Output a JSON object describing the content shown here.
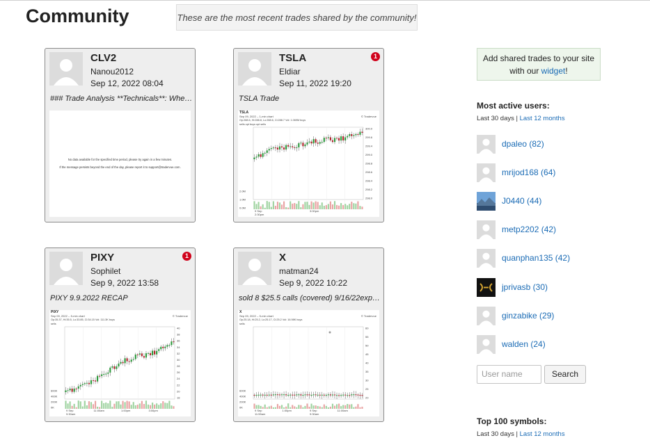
{
  "page": {
    "title": "Community",
    "intro": "These are the most recent trades shared by the community!"
  },
  "trades": [
    {
      "symbol": "CLV2",
      "user": "Nanou2012",
      "date": "Sep 12, 2022 08:04",
      "description": "### Trade Analysis **Technicals**: Whe…",
      "badge": "",
      "chart": {
        "no_data_line1": "No data available for the specified time period, please try again in a few minutes.",
        "no_data_line2": "If the message persists beyond the end of the day, please report it to support@tradervue.com."
      }
    },
    {
      "symbol": "TSLA",
      "user": "Eldiar",
      "date": "Sep 11, 2022 19:20",
      "description": "TSLA Trade",
      "badge": "1",
      "chart": {
        "title": "TSLA",
        "subtitle": "Sep 09, 2022 -- 1-min chart",
        "source": "© Tradervue",
        "legend": "Op:288.6, Hi:288.8, Lo:288.6, Cl:288.7   Vol: 1.069M   buys",
        "legend2": "sells   opt buys   opt sells",
        "y_ticks": [
          "300.0",
          "299.6",
          "299.4",
          "299.0",
          "298.8",
          "298.6",
          "298.4",
          "298.2",
          "298.0"
        ],
        "vol_ticks": [
          "2.0M",
          "1.0M",
          "0.0M"
        ],
        "x_ticks": [
          "9 Sep 2:30pm",
          "3:00pm"
        ]
      }
    },
    {
      "symbol": "PIXY",
      "user": "Sophilet",
      "date": "Sep 9, 2022 13:58",
      "description": "PIXY 9.9.2022 RECAP",
      "badge": "1",
      "chart": {
        "title": "PIXY",
        "subtitle": "Sep 09, 2022 -- 5-min chart",
        "source": "© Tradervue",
        "legend": "Op:35.37, Hi:35.5, Lo:33.85, Cl:34.15   Vol: 111.3K   buys",
        "legend2": "sells",
        "y_ticks": [
          "40",
          "38",
          "36",
          "34",
          "32",
          "30",
          "28",
          "26",
          "24",
          "22",
          "20",
          "18"
        ],
        "vol_ticks": [
          "600K",
          "400K",
          "200K",
          "0K"
        ],
        "x_ticks": [
          "9 Sep 9:30am",
          "11:00am",
          "1:00pm",
          "3:00pm"
        ]
      }
    },
    {
      "symbol": "X",
      "user": "matman24",
      "date": "Sep 9, 2022 10:22",
      "description": "sold 8 $25.5 calls (covered) 9/16/22exp …",
      "badge": "",
      "chart": {
        "title": "X",
        "subtitle": "Sep 09, 2022 -- 5-min chart",
        "source": "© Tradervue",
        "legend": "Op:25.18, Hi:25.2, Lo:25.17, Cl:25.2   Vol: 16.98K   buys",
        "legend2": "sells",
        "y_ticks": [
          "60",
          "55",
          "50",
          "45",
          "40",
          "35",
          "30",
          "25",
          "20"
        ],
        "vol_ticks": [
          "600K",
          "400K",
          "200K",
          "0K"
        ],
        "x_ticks": [
          "9 Sep 11:55am",
          "1:00pm",
          "9 Sep 9:30am",
          "11:00am"
        ]
      }
    }
  ],
  "sidebar": {
    "widget_text_before": "Add shared trades to your site with our ",
    "widget_link": "widget",
    "widget_text_after": "!",
    "active_title": "Most active users:",
    "active_period": "Last 30 days",
    "active_sep": " | ",
    "active_alt": "Last 12 months",
    "users": [
      {
        "name": "dpaleo (82)",
        "avatar": "default"
      },
      {
        "name": "mrijod168 (64)",
        "avatar": "default"
      },
      {
        "name": "J0440 (44)",
        "avatar": "landscape"
      },
      {
        "name": "metp2202 (42)",
        "avatar": "default"
      },
      {
        "name": "quanphan135 (42)",
        "avatar": "default"
      },
      {
        "name": "jprivasb (30)",
        "avatar": "logo"
      },
      {
        "name": "ginzabike (29)",
        "avatar": "default"
      },
      {
        "name": "walden (24)",
        "avatar": "default"
      }
    ],
    "search_placeholder": "User name",
    "search_button": "Search",
    "symbols_title": "Top 100 symbols:",
    "symbols_period": "Last 30 days",
    "symbols_alt": "Last 12 months"
  },
  "colors": {
    "link": "#1a6bb5",
    "badge": "#d0021b",
    "candle_up": "#2a9a3a",
    "candle_down": "#b3202a"
  }
}
